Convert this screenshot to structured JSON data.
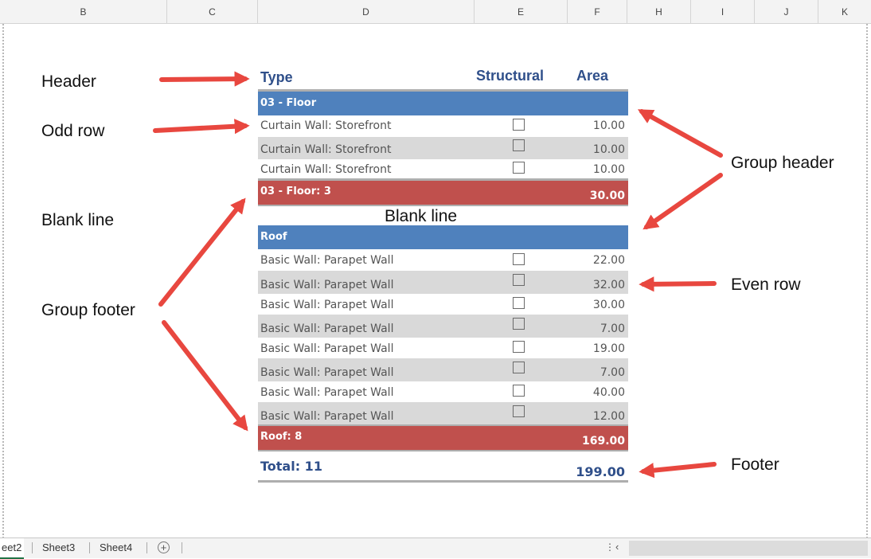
{
  "columns": [
    "B",
    "C",
    "D",
    "E",
    "F",
    "H",
    "I",
    "J",
    "K"
  ],
  "schedule": {
    "header": {
      "type": "Type",
      "structural": "Structural",
      "area": "Area"
    },
    "group1": {
      "header": "03 - Floor",
      "rows": [
        {
          "type": "Curtain Wall: Storefront",
          "area": "10.00"
        },
        {
          "type": "Curtain Wall: Storefront",
          "area": "10.00"
        },
        {
          "type": "Curtain Wall: Storefront",
          "area": "10.00"
        }
      ],
      "footer_label": "03 - Floor: 3",
      "footer_area": "30.00"
    },
    "blank_line": "Blank line",
    "group2": {
      "header": "Roof",
      "rows": [
        {
          "type": "Basic Wall: Parapet Wall",
          "area": "22.00"
        },
        {
          "type": "Basic Wall: Parapet Wall",
          "area": "32.00"
        },
        {
          "type": "Basic Wall: Parapet Wall",
          "area": "30.00"
        },
        {
          "type": "Basic Wall: Parapet Wall",
          "area": "7.00"
        },
        {
          "type": "Basic Wall: Parapet Wall",
          "area": "19.00"
        },
        {
          "type": "Basic Wall: Parapet Wall",
          "area": "7.00"
        },
        {
          "type": "Basic Wall: Parapet Wall",
          "area": "40.00"
        },
        {
          "type": "Basic Wall: Parapet Wall",
          "area": "12.00"
        }
      ],
      "footer_label": "Roof: 8",
      "footer_area": "169.00"
    },
    "total_label": "Total: 11",
    "total_area": "199.00"
  },
  "annotations": {
    "header": "Header",
    "odd_row": "Odd row",
    "blank_line": "Blank line",
    "group_footer": "Group footer",
    "group_header": "Group header",
    "even_row": "Even row",
    "footer": "Footer"
  },
  "colors": {
    "group_header": "#4f81bd",
    "group_footer": "#c0504d",
    "even_row": "#d9d9d9",
    "header_text": "#2f4f8a",
    "arrow": "#e8473f"
  },
  "sheet_tabs": [
    "eet2",
    "Sheet3",
    "Sheet4"
  ],
  "add_sheet_icon": "plus-circle-icon"
}
